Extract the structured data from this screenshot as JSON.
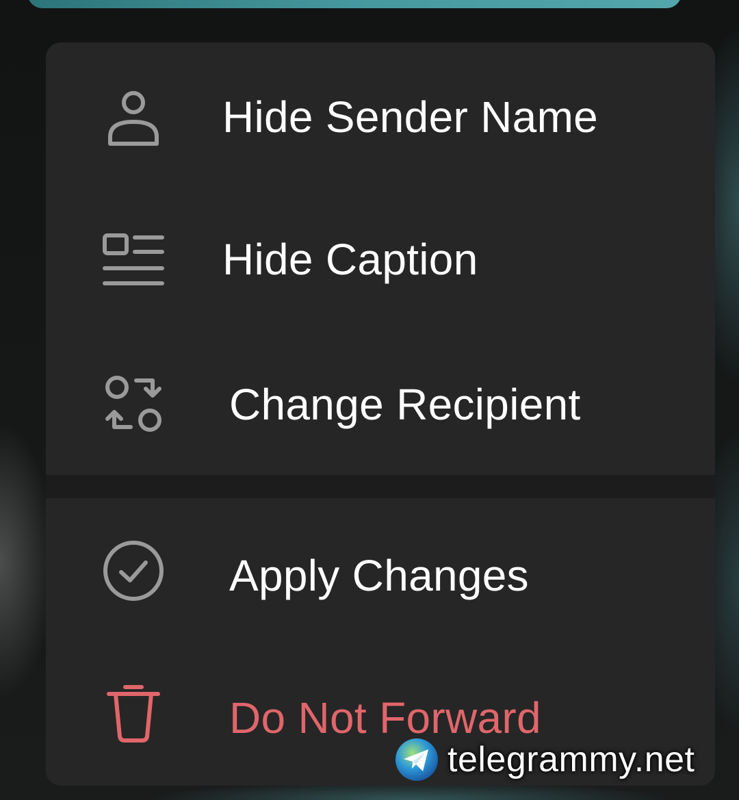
{
  "menu": {
    "items": [
      {
        "label": "Hide Sender Name",
        "icon": "person-icon"
      },
      {
        "label": "Hide Caption",
        "icon": "caption-icon"
      },
      {
        "label": "Change Recipient",
        "icon": "swap-icon"
      }
    ],
    "actions": [
      {
        "label": "Apply Changes",
        "icon": "check-circle-icon"
      },
      {
        "label": "Do Not Forward",
        "icon": "trash-icon",
        "color": "#e0666b"
      }
    ]
  },
  "watermark": {
    "text": "telegrammy.net",
    "icon": "telegram-globe-icon"
  },
  "colors": {
    "menu_background": "#262626",
    "text": "#ffffff",
    "icon": "#9a9a9a",
    "danger": "#e0666b"
  }
}
